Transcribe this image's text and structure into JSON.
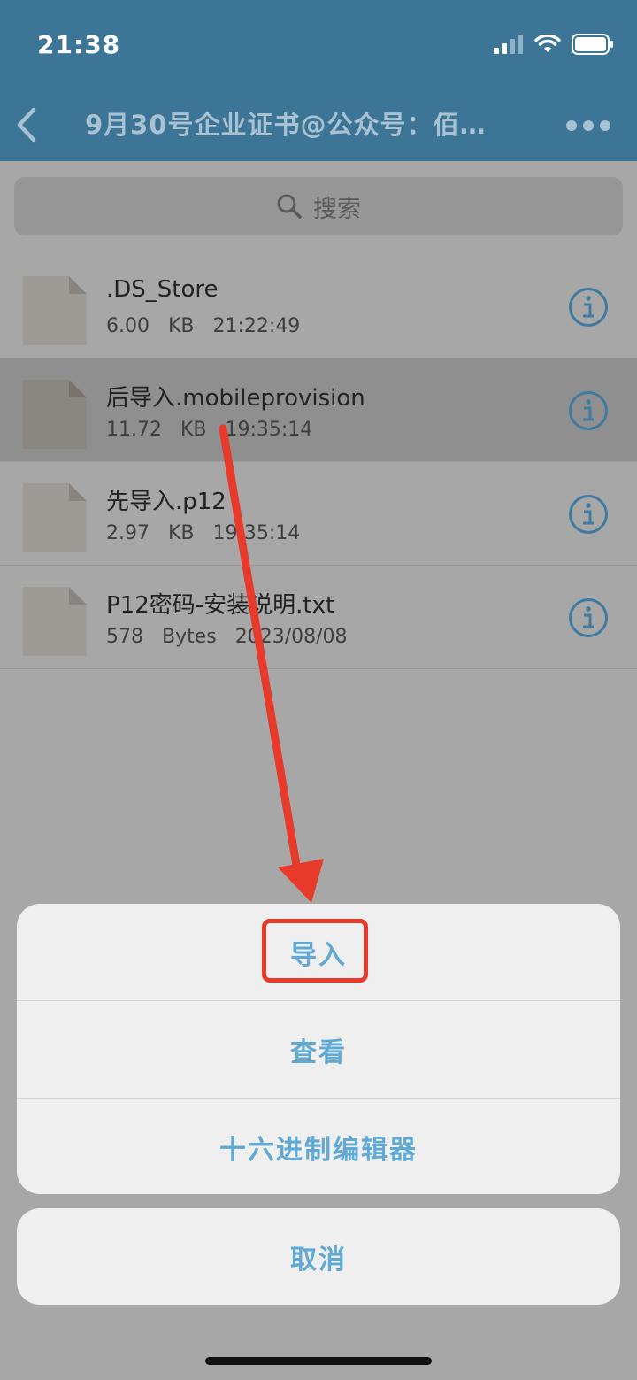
{
  "status_bar": {
    "time": "21:38"
  },
  "nav": {
    "title": "9月30号企业证书@公众号：佰…"
  },
  "search": {
    "placeholder": "搜索"
  },
  "files": [
    {
      "name": ".DS_Store",
      "size": "6.00 KB",
      "time": "21:22:49"
    },
    {
      "name": "后导入.mobileprovision",
      "size": "11.72 KB",
      "time": "19:35:14",
      "selected": true
    },
    {
      "name": "先导入.p12",
      "size": "2.97 KB",
      "time": "19:35:14"
    },
    {
      "name": "P12密码-安装说明.txt",
      "size": "578 Bytes",
      "time": "2023/08/08"
    }
  ],
  "action_sheet": {
    "import_label": "导入",
    "view_label": "查看",
    "hex_editor_label": "十六进制编辑器",
    "cancel_label": "取消"
  },
  "colors": {
    "nav_background": "#3d7596",
    "action_text": "#5fa9d3",
    "annotation": "#e83a2a"
  }
}
